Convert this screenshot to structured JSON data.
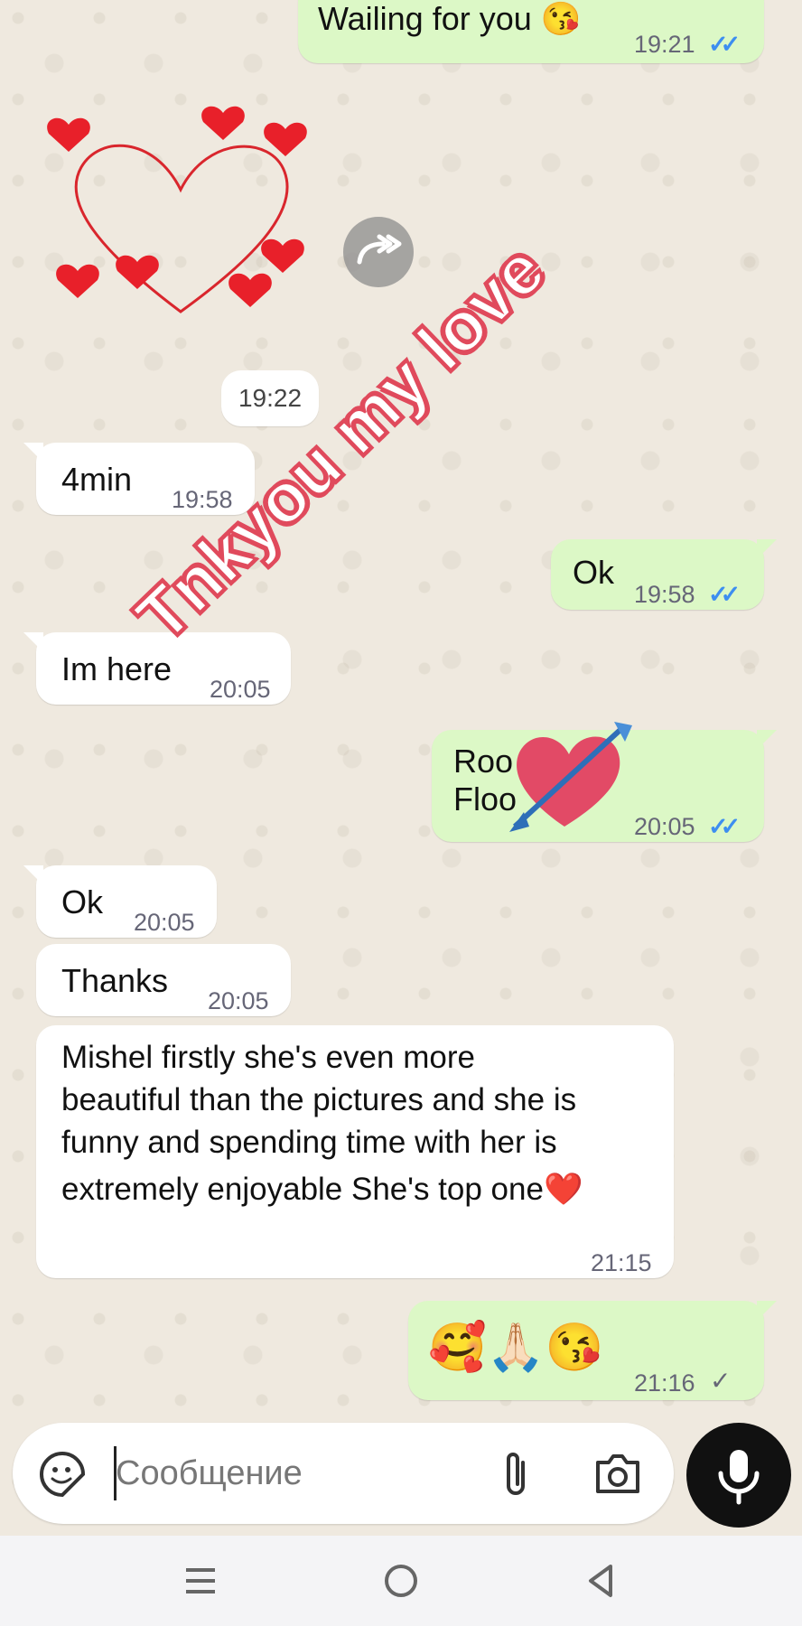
{
  "overlay": {
    "caption": "Tnkyou my love"
  },
  "date_chip": {
    "label": "19:22"
  },
  "messages": [
    {
      "id": "m1",
      "dir": "out",
      "text": "Wailing for you 😘",
      "time": "19:21",
      "status": "read"
    },
    {
      "id": "m2",
      "dir": "in",
      "text": "4min",
      "time": "19:58"
    },
    {
      "id": "m3",
      "dir": "out",
      "text": "Ok",
      "time": "19:58",
      "status": "read"
    },
    {
      "id": "m4",
      "dir": "in",
      "text": "Im here",
      "time": "20:05"
    },
    {
      "id": "m5",
      "dir": "out",
      "text_line1": "Roo",
      "text_line2": "Floo",
      "time": "20:05",
      "status": "read"
    },
    {
      "id": "m6",
      "dir": "in",
      "text": "Ok",
      "time": "20:05"
    },
    {
      "id": "m7",
      "dir": "in",
      "text": "Thanks",
      "time": "20:05"
    },
    {
      "id": "m8",
      "dir": "in",
      "lines": [
        "Mishel firstly she's even more",
        "beautiful than the pictures and she is",
        "funny and spending time with her is",
        "extremely enjoyable She's top one❤️"
      ],
      "time": "21:15"
    },
    {
      "id": "m9",
      "dir": "out",
      "text": "🥰🙏🏻😘",
      "time": "21:16",
      "status": "sent"
    }
  ],
  "ticks": {
    "read": "✓✓",
    "sent": "✓"
  },
  "composer": {
    "placeholder": "Сообщение",
    "value": ""
  },
  "icons": {
    "sticker": "sticker-icon",
    "attach": "paperclip-icon",
    "camera": "camera-icon",
    "mic": "microphone-icon",
    "forward": "forward-icon",
    "nav_menu": "menu-icon",
    "nav_home": "home-icon",
    "nav_back": "back-icon"
  },
  "colors": {
    "outgoing": "#dcf8c6",
    "incoming": "#ffffff",
    "read_ticks": "#3d8ef0",
    "overlay_stroke": "#e04a5c",
    "hearts": "#e8202a"
  }
}
